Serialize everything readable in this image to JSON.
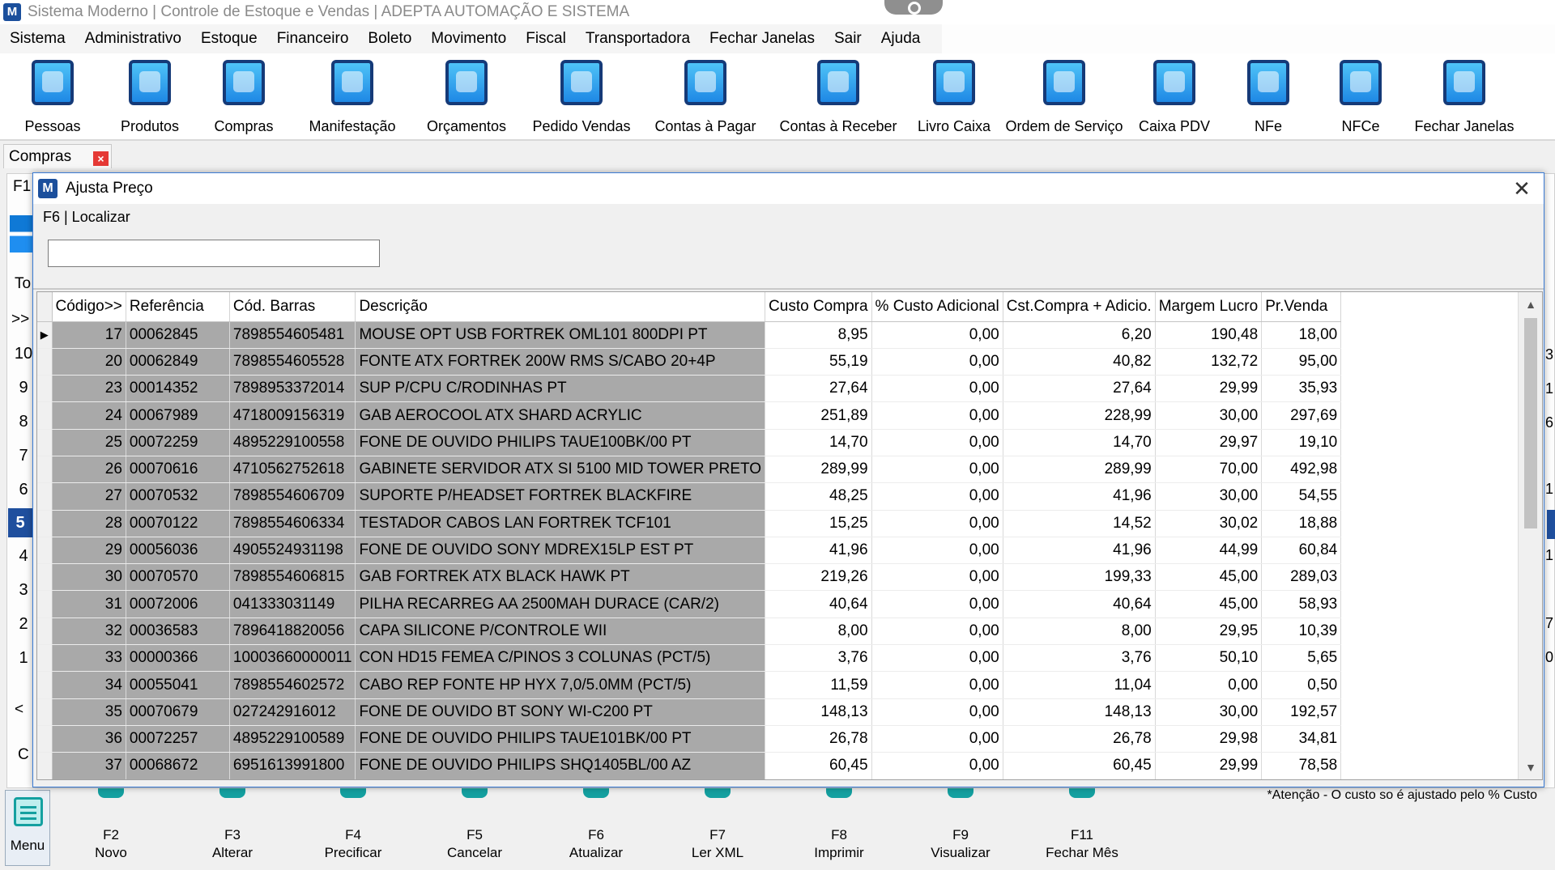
{
  "window": {
    "title": "Sistema Moderno | Controle de Estoque e Vendas | ADEPTA AUTOMAÇÃO E SISTEMA",
    "logo_letter": "M"
  },
  "menubar": [
    "Sistema",
    "Administrativo",
    "Estoque",
    "Financeiro",
    "Boleto",
    "Movimento",
    "Fiscal",
    "Transportadora",
    "Fechar Janelas",
    "Sair",
    "Ajuda"
  ],
  "toolbar": [
    {
      "label": "Pessoas",
      "icon": "people-icon"
    },
    {
      "label": "Produtos",
      "icon": "products-icon"
    },
    {
      "label": "Compras",
      "icon": "cart-icon"
    },
    {
      "label": "Manifestação",
      "icon": "manifest-icon"
    },
    {
      "label": "Orçamentos",
      "icon": "percent-icon"
    },
    {
      "label": "Pedido Vendas",
      "icon": "dollar-icon"
    },
    {
      "label": "Contas à Pagar",
      "icon": "bills-pay-icon"
    },
    {
      "label": "Contas à Receber",
      "icon": "bills-receive-icon"
    },
    {
      "label": "Livro Caixa",
      "icon": "cashbook-icon"
    },
    {
      "label": "Ordem de Serviço",
      "icon": "gears-icon"
    },
    {
      "label": "Caixa PDV",
      "icon": "cash-register-icon"
    },
    {
      "label": "NFe",
      "icon": "nfe-icon"
    },
    {
      "label": "NFCe",
      "icon": "nfce-icon"
    },
    {
      "label": "Fechar Janelas",
      "icon": "close-windows-icon"
    }
  ],
  "doc_tab": {
    "label": "Compras",
    "close": "×"
  },
  "background": {
    "f1_label": "F1",
    "to_label": "To",
    "nav_label": ">>",
    "row_labels": [
      "10",
      "9",
      "8",
      "7",
      "6",
      "5",
      "4",
      "3",
      "2",
      "1"
    ],
    "selected_row": "5",
    "scroll_left": "<",
    "c_label": "C",
    "right_marks": [
      "3",
      "1",
      "6",
      "1",
      "1",
      "7",
      "0"
    ]
  },
  "dialog": {
    "title": "Ajusta Preço",
    "logo_letter": "M",
    "close": "✕",
    "find_label": "F6 | Localizar",
    "find_value": "",
    "footnote": "*Atenção - O custo so é ajustado pelo % Custo"
  },
  "grid": {
    "columns": [
      "Código>>",
      "Referência",
      "Cód. Barras",
      "Descrição",
      "Custo Compra",
      "% Custo Adicional",
      "Cst.Compra + Adicio.",
      "Margem Lucro",
      "Pr.Venda"
    ],
    "rows": [
      [
        "17",
        "00062845",
        "7898554605481",
        "MOUSE OPT USB FORTREK OML101 800DPI PT",
        "8,95",
        "0,00",
        "6,20",
        "190,48",
        "18,00"
      ],
      [
        "20",
        "00062849",
        "7898554605528",
        "FONTE ATX FORTREK 200W RMS S/CABO 20+4P",
        "55,19",
        "0,00",
        "40,82",
        "132,72",
        "95,00"
      ],
      [
        "23",
        "00014352",
        "7898953372014",
        "SUP P/CPU C/RODINHAS PT",
        "27,64",
        "0,00",
        "27,64",
        "29,99",
        "35,93"
      ],
      [
        "24",
        "00067989",
        "4718009156319",
        "GAB AEROCOOL ATX SHARD ACRYLIC",
        "251,89",
        "0,00",
        "228,99",
        "30,00",
        "297,69"
      ],
      [
        "25",
        "00072259",
        "4895229100558",
        "FONE DE OUVIDO PHILIPS TAUE100BK/00 PT",
        "14,70",
        "0,00",
        "14,70",
        "29,97",
        "19,10"
      ],
      [
        "26",
        "00070616",
        "4710562752618",
        "GABINETE SERVIDOR ATX SI 5100 MID TOWER PRETO",
        "289,99",
        "0,00",
        "289,99",
        "70,00",
        "492,98"
      ],
      [
        "27",
        "00070532",
        "7898554606709",
        "SUPORTE P/HEADSET FORTREK BLACKFIRE",
        "48,25",
        "0,00",
        "41,96",
        "30,00",
        "54,55"
      ],
      [
        "28",
        "00070122",
        "7898554606334",
        "TESTADOR CABOS LAN FORTREK TCF101",
        "15,25",
        "0,00",
        "14,52",
        "30,02",
        "18,88"
      ],
      [
        "29",
        "00056036",
        "4905524931198",
        "FONE DE OUVIDO SONY MDREX15LP EST PT",
        "41,96",
        "0,00",
        "41,96",
        "44,99",
        "60,84"
      ],
      [
        "30",
        "00070570",
        "7898554606815",
        "GAB FORTREK ATX BLACK HAWK PT",
        "219,26",
        "0,00",
        "199,33",
        "45,00",
        "289,03"
      ],
      [
        "31",
        "00072006",
        "041333031149",
        "PILHA RECARREG AA 2500MAH DURACE (CAR/2)",
        "40,64",
        "0,00",
        "40,64",
        "45,00",
        "58,93"
      ],
      [
        "32",
        "00036583",
        "7896418820056",
        "CAPA SILICONE P/CONTROLE WII",
        "8,00",
        "0,00",
        "8,00",
        "29,95",
        "10,39"
      ],
      [
        "33",
        "00000366",
        "10003660000011",
        "CON HD15 FEMEA C/PINOS 3 COLUNAS (PCT/5)",
        "3,76",
        "0,00",
        "3,76",
        "50,10",
        "5,65"
      ],
      [
        "34",
        "00055041",
        "7898554602572",
        "CABO REP FONTE HP HYX 7,0/5.0MM (PCT/5)",
        "11,59",
        "0,00",
        "11,04",
        "0,00",
        "0,50"
      ],
      [
        "35",
        "00070679",
        "027242916012",
        "FONE DE OUVIDO BT SONY WI-C200 PT",
        "148,13",
        "0,00",
        "148,13",
        "30,00",
        "192,57"
      ],
      [
        "36",
        "00072257",
        "4895229100589",
        "FONE DE OUVIDO PHILIPS TAUE101BK/00 PT",
        "26,78",
        "0,00",
        "26,78",
        "29,98",
        "34,81"
      ],
      [
        "37",
        "00068672",
        "6951613991800",
        "FONE DE OUVIDO PHILIPS SHQ1405BL/00 AZ",
        "60,45",
        "0,00",
        "60,45",
        "29,99",
        "78,58"
      ]
    ]
  },
  "funcbar": {
    "menu_label": "Menu",
    "keys": [
      {
        "code": "F2",
        "label": "Novo"
      },
      {
        "code": "F3",
        "label": "Alterar"
      },
      {
        "code": "F4",
        "label": "Precificar"
      },
      {
        "code": "F5",
        "label": "Cancelar"
      },
      {
        "code": "F6",
        "label": "Atualizar"
      },
      {
        "code": "F7",
        "label": "Ler XML"
      },
      {
        "code": "F8",
        "label": "Imprimir"
      },
      {
        "code": "F9",
        "label": "Visualizar"
      },
      {
        "code": "F11",
        "label": "Fechar Mês"
      }
    ]
  }
}
